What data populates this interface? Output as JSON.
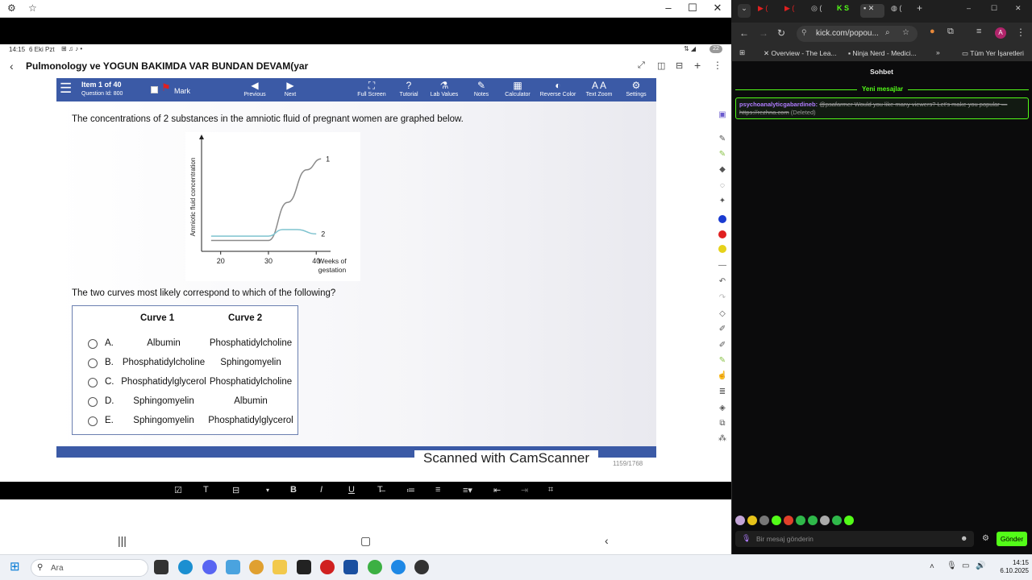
{
  "left_window": {
    "status": {
      "time": "14:15",
      "date": "6 Eki Pzt",
      "battery": "22"
    },
    "app_title": "Pulmonology ve YOGUN BAKIMDA VAR BUNDAN DEVAM(yar",
    "exam_toolbar": {
      "item": "Item 1 of 40",
      "question_id": "Question Id: 800",
      "mark": "Mark",
      "buttons": [
        "Previous",
        "Next",
        "Full Screen",
        "Tutorial",
        "Lab Values",
        "Notes",
        "Calculator",
        "Reverse Color",
        "Text Zoom",
        "Settings"
      ]
    },
    "question": {
      "stem": "The concentrations of 2 substances in the amniotic fluid of pregnant women are graphed below.",
      "prompt": "The two curves most likely correspond to which of the following?",
      "table_headers": [
        "Curve 1",
        "Curve 2"
      ],
      "options": [
        {
          "letter": "A.",
          "curve1": "Albumin",
          "curve2": "Phosphatidylcholine"
        },
        {
          "letter": "B.",
          "curve1": "Phosphatidylcholine",
          "curve2": "Sphingomyelin"
        },
        {
          "letter": "C.",
          "curve1": "Phosphatidylglycerol",
          "curve2": "Phosphatidylcholine"
        },
        {
          "letter": "D.",
          "curve1": "Sphingomyelin",
          "curve2": "Albumin"
        },
        {
          "letter": "E.",
          "curve1": "Sphingomyelin",
          "curve2": "Phosphatidylglycerol"
        }
      ]
    },
    "chart_data": {
      "type": "line",
      "ylabel": "Amniotic fluid concentration",
      "xlabel": "Weeks of gestation",
      "x_ticks": [
        20,
        30,
        40
      ],
      "series": [
        {
          "name": "1",
          "x": [
            18,
            30,
            34,
            38,
            41
          ],
          "y": [
            1.0,
            1.0,
            4.5,
            7.5,
            8.5
          ]
        },
        {
          "name": "2",
          "x": [
            18,
            30,
            33,
            36,
            40
          ],
          "y": [
            1.4,
            1.4,
            2.0,
            2.0,
            1.6
          ]
        }
      ],
      "xlim": [
        16,
        43
      ],
      "ylim": [
        0,
        10
      ]
    },
    "scan_overlay": "Scanned with CamScanner",
    "page_count": "1159/1768",
    "format_tools": [
      "☑",
      "T",
      "⊟",
      "▾",
      "B",
      "I",
      "U",
      "T̶",
      "≔",
      "≡",
      "≡▾",
      "⇤",
      "⇥",
      "⌗"
    ]
  },
  "right_window": {
    "address": "kick.com/popou...",
    "bookmarks": [
      "Overview - The Lea...",
      "Ninja Nerd - Medici...",
      "Tüm Yer İşaretleri"
    ],
    "chat_title": "Sohbet",
    "new_messages_label": "Yeni mesajlar",
    "message": {
      "user": "psychoanalyticgabardineb:",
      "text": "@psafarmer Would you like many viewers? Let's make you popular — https://rezhna.com",
      "tag": "(Deleted)"
    },
    "input_placeholder": "Bir mesaj gönderin",
    "send_label": "Gönder",
    "colors": {
      "accent": "#53fc18"
    }
  },
  "taskbar": {
    "search_placeholder": "Ara",
    "time": "14:15",
    "date": "6.10.2025"
  }
}
